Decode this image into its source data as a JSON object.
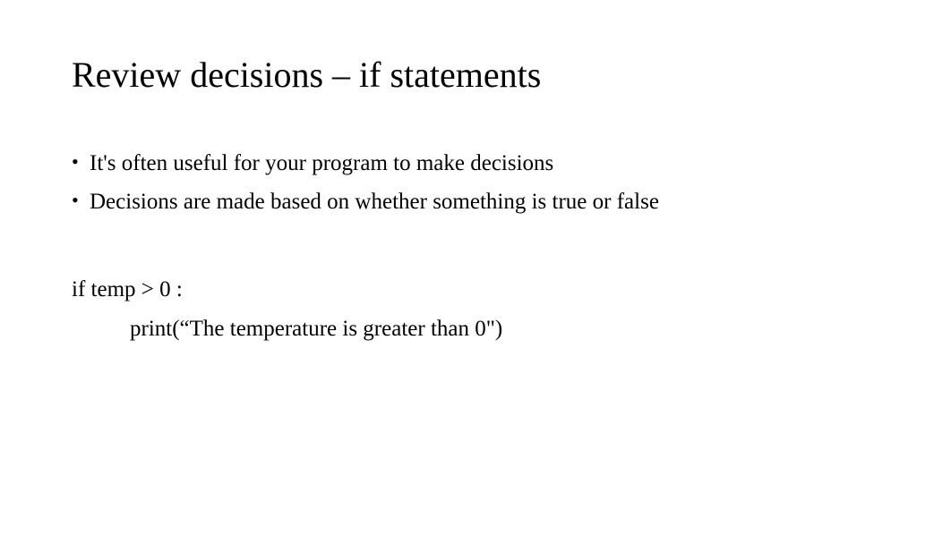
{
  "title": "Review decisions – if statements",
  "bullets": [
    "It's often useful for your program to make decisions",
    "Decisions are made based on whether something is true or false"
  ],
  "code": {
    "line1": "if temp > 0 :",
    "line2": "print(“The temperature is greater than 0\")"
  }
}
